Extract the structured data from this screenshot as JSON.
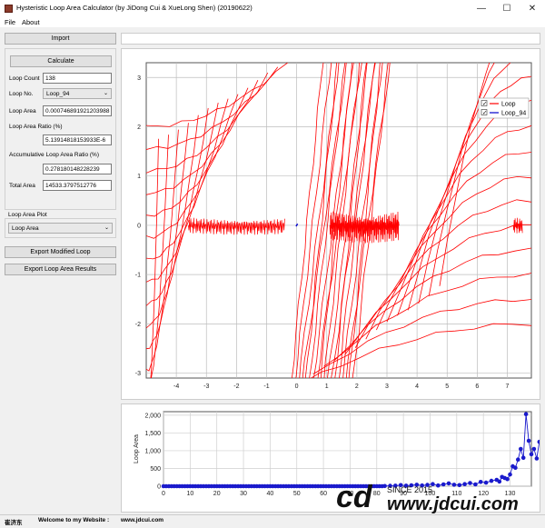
{
  "window": {
    "title": "Hysteristic Loop Area Calculator (by JiDong Cui & XueLong Shen) (20190622)",
    "minimize": "—",
    "maximize": "☐",
    "close": "✕"
  },
  "menu": {
    "file": "File",
    "about": "About"
  },
  "left": {
    "import_label": "Import",
    "calculate_label": "Calculate",
    "loop_count_label": "Loop Count",
    "loop_count_value": "138",
    "loop_no_label": "Loop No.",
    "loop_no_value": "Loop_94",
    "loop_area_label": "Loop Area",
    "loop_area_value": "0.000746891921203988",
    "loop_area_ratio_label": "Loop Area Ratio (%)",
    "loop_area_ratio_value": "5.13914818153933E-6",
    "acc_ratio_label": "Accumulative Loop Area Ratio (%)",
    "acc_ratio_value": "0.278180148228239",
    "total_area_label": "Total Area",
    "total_area_value": "14533.3797512776",
    "loop_area_plot_label": "Loop Area Plot",
    "loop_area_plot_value": "Loop Area",
    "export_modified_label": "Export Modified Loop",
    "export_results_label": "Export Loop Area Results"
  },
  "status": {
    "name": "崔济东",
    "welcome": "Welcome to my Website :",
    "website": "www.jdcui.com"
  },
  "watermark": {
    "since": "SINCE 2015",
    "domain": "www.jdcui.com"
  },
  "chart_data": [
    {
      "type": "line",
      "title": "",
      "xlabel": "",
      "ylabel": "",
      "xlim": [
        -5,
        7.8
      ],
      "ylim": [
        -3.1,
        3.3
      ],
      "x_ticks": [
        -4,
        -3,
        -2,
        -1,
        0,
        1,
        2,
        3,
        4,
        5,
        6,
        7
      ],
      "y_ticks": [
        -3,
        -2,
        -1,
        0,
        1,
        2,
        3
      ],
      "grid": true,
      "legend_position": "top-right",
      "series": [
        {
          "name": "Loop",
          "color": "#ff0000",
          "checked": true
        },
        {
          "name": "Loop_94",
          "color": "#0000cc",
          "checked": true
        }
      ]
    },
    {
      "type": "scatter",
      "title": "",
      "xlabel": "",
      "ylabel": "Loop Area",
      "xlim": [
        0,
        138
      ],
      "ylim": [
        0,
        2100
      ],
      "x_ticks": [
        0,
        10,
        20,
        30,
        40,
        50,
        60,
        70,
        80,
        90,
        100,
        110,
        120,
        130
      ],
      "y_ticks": [
        0,
        500,
        1000,
        1500,
        2000
      ],
      "y_tick_labels": [
        "0",
        "500",
        "1,000",
        "1,500",
        "2,000"
      ],
      "grid": true,
      "color": "#1a1acc",
      "points": [
        [
          83,
          5
        ],
        [
          85,
          10
        ],
        [
          87,
          15
        ],
        [
          89,
          30
        ],
        [
          91,
          15
        ],
        [
          93,
          25
        ],
        [
          95,
          40
        ],
        [
          97,
          20
        ],
        [
          99,
          35
        ],
        [
          101,
          60
        ],
        [
          103,
          20
        ],
        [
          105,
          50
        ],
        [
          107,
          80
        ],
        [
          109,
          40
        ],
        [
          111,
          30
        ],
        [
          113,
          60
        ],
        [
          115,
          90
        ],
        [
          117,
          50
        ],
        [
          119,
          120
        ],
        [
          121,
          100
        ],
        [
          123,
          150
        ],
        [
          125,
          180
        ],
        [
          126,
          130
        ],
        [
          127,
          260
        ],
        [
          128,
          230
        ],
        [
          129,
          200
        ],
        [
          130,
          330
        ],
        [
          131,
          560
        ],
        [
          132,
          520
        ],
        [
          133,
          750
        ],
        [
          134,
          1050
        ],
        [
          135,
          800
        ],
        [
          136,
          2030
        ],
        [
          137,
          1280
        ],
        [
          138,
          900
        ],
        [
          139,
          1050
        ],
        [
          140,
          780
        ],
        [
          141,
          1250
        ]
      ]
    }
  ]
}
